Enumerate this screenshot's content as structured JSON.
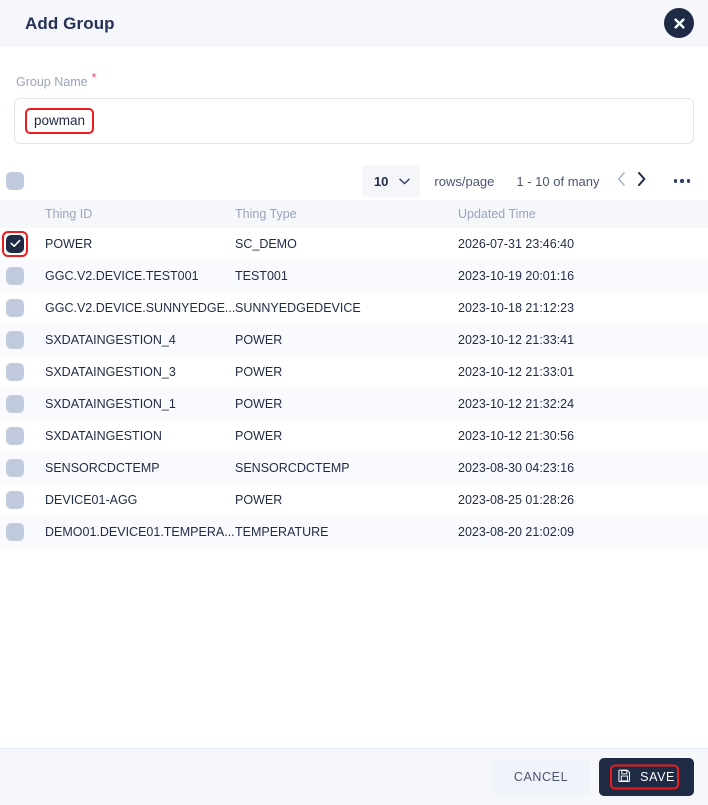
{
  "dialog": {
    "title": "Add Group",
    "close_icon": "close-icon"
  },
  "form": {
    "label": "Group Name",
    "required_mark": "*",
    "value": "powman",
    "placeholder": ""
  },
  "toolbar": {
    "select_all_checked": false,
    "rows_per_page_value": "10",
    "rows_per_page_label": "rows/page",
    "range_text": "1 - 10 of many",
    "prev_icon": "chevron-left-icon",
    "next_icon": "chevron-right-icon",
    "more_icon": "more-horizontal-icon",
    "dropdown_icon": "chevron-down-icon"
  },
  "table": {
    "columns": [
      "Thing ID",
      "Thing Type",
      "Updated Time"
    ],
    "rows": [
      {
        "checked": true,
        "id": "POWER",
        "type": "SC_DEMO",
        "updated": "2026-07-31 23:46:40"
      },
      {
        "checked": false,
        "id": "GGC.V2.DEVICE.TEST001",
        "type": "TEST001",
        "updated": "2023-10-19 20:01:16"
      },
      {
        "checked": false,
        "id": "GGC.V2.DEVICE.SUNNYEDGE...",
        "type": "SUNNYEDGEDEVICE",
        "updated": "2023-10-18 21:12:23"
      },
      {
        "checked": false,
        "id": "SXDATAINGESTION_4",
        "type": "POWER",
        "updated": "2023-10-12 21:33:41"
      },
      {
        "checked": false,
        "id": "SXDATAINGESTION_3",
        "type": "POWER",
        "updated": "2023-10-12 21:33:01"
      },
      {
        "checked": false,
        "id": "SXDATAINGESTION_1",
        "type": "POWER",
        "updated": "2023-10-12 21:32:24"
      },
      {
        "checked": false,
        "id": "SXDATAINGESTION",
        "type": "POWER",
        "updated": "2023-10-12 21:30:56"
      },
      {
        "checked": false,
        "id": "SENSORCDCTEMP",
        "type": "SENSORCDCTEMP",
        "updated": "2023-08-30 04:23:16"
      },
      {
        "checked": false,
        "id": "DEVICE01-AGG",
        "type": "POWER",
        "updated": "2023-08-25 01:28:26"
      },
      {
        "checked": false,
        "id": "DEMO01.DEVICE01.TEMPERA...",
        "type": "TEMPERATURE",
        "updated": "2023-08-20 21:02:09"
      }
    ]
  },
  "footer": {
    "cancel_label": "CANCEL",
    "save_label": "SAVE",
    "save_icon": "save-floppy-icon"
  },
  "colors": {
    "header_bg": "#f5f7fb",
    "accent_dark": "#1f2a44",
    "required_red": "#f0506e",
    "annotation_red": "#ee1c1c",
    "muted_text": "#9aa3bb",
    "checkbox_idle": "#c2cadd",
    "row_alt_bg": "#f8fafd"
  }
}
